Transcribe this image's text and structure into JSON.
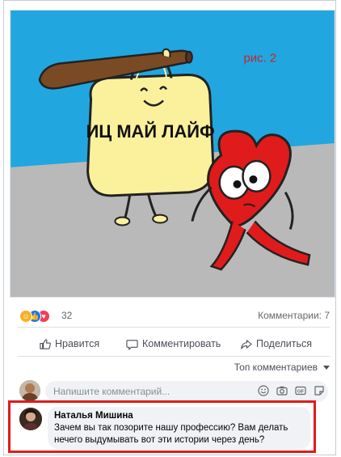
{
  "post": {
    "image": {
      "annotation": "рис. 2",
      "bag_text": "ИЦ МАЙ ЛАЙФ",
      "colors": {
        "sky": "#22a6e0",
        "ground": "#b9b9b9",
        "bag": "#fbf19c",
        "heart": "#e01b1b",
        "bat": "#7a4a24"
      }
    },
    "reactions": {
      "icons": [
        "haha-icon",
        "like-icon",
        "love-icon"
      ],
      "count": "32",
      "comments_label": "Комментарии: 7"
    },
    "actions": {
      "like_label": "Нравится",
      "comment_label": "Комментировать",
      "share_label": "Поделиться"
    },
    "sort_label": "Топ комментариев",
    "composer": {
      "placeholder": "Напишите комментарий..."
    },
    "comment": {
      "author": "Наталья Мишина",
      "text_line1": "Зачем вы так позорите нашу профессию? Вам делать",
      "text_line2": "нечего выдумывать вот эти истории через день?"
    },
    "highlight_color": "#e21b1b"
  }
}
